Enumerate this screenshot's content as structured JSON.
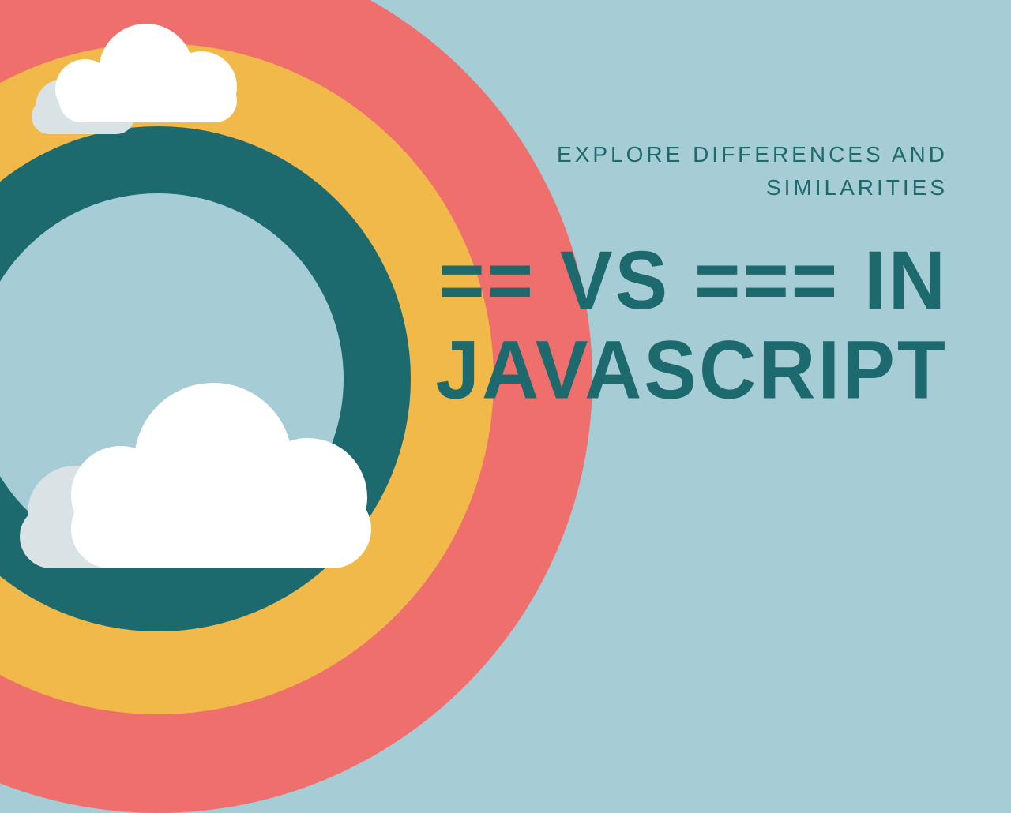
{
  "subtitle_line1": "EXPLORE DIFFERENCES AND",
  "subtitle_line2": "SIMILARITIES",
  "title_line1": "== VS === IN",
  "title_line2": "JAVASCRIPT"
}
